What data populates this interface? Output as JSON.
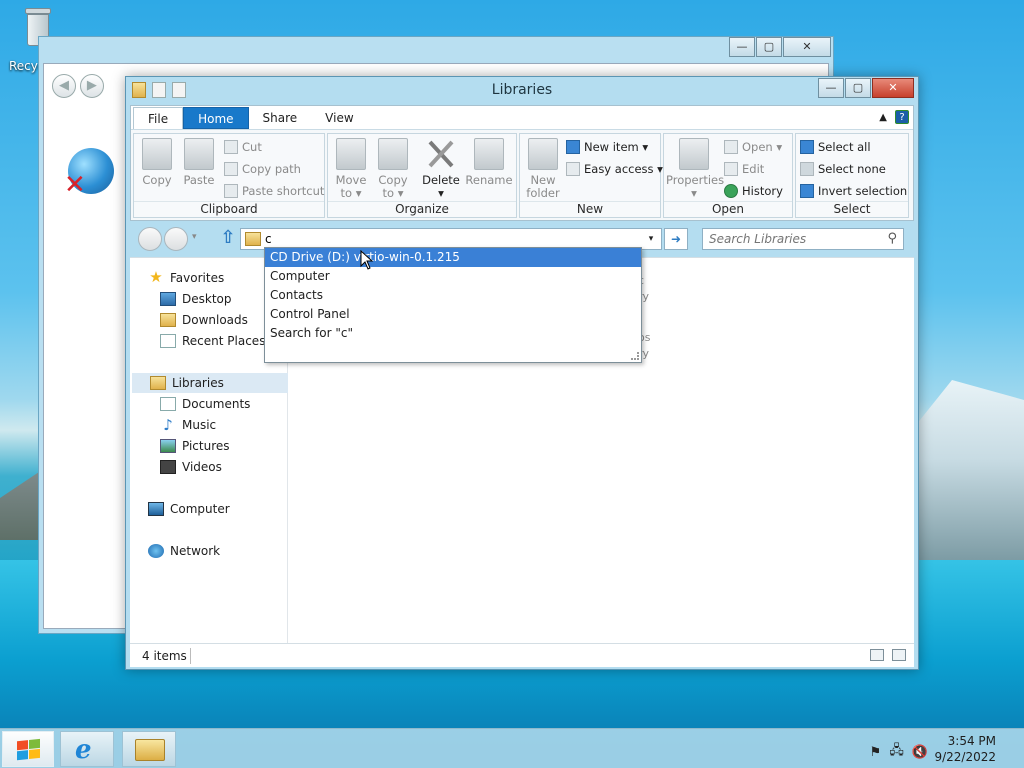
{
  "desktop": {
    "recycle_bin_label": "Recyc"
  },
  "window": {
    "title": "Libraries",
    "controls": {
      "minimize": "—",
      "maximize": "▢",
      "close": "✕"
    }
  },
  "ribbon": {
    "tabs": [
      {
        "label": "File"
      },
      {
        "label": "Home"
      },
      {
        "label": "Share"
      },
      {
        "label": "View"
      }
    ],
    "help": "?",
    "groups": {
      "clipboard": {
        "label": "Clipboard",
        "copy": "Copy",
        "paste": "Paste",
        "cut": "Cut",
        "copy_path": "Copy path",
        "paste_shortcut": "Paste shortcut"
      },
      "organize": {
        "label": "Organize",
        "move_to_1": "Move",
        "move_to_2": "to ▾",
        "copy_to_1": "Copy",
        "copy_to_2": "to ▾",
        "delete": "Delete",
        "delete_arrow": "▾",
        "rename": "Rename"
      },
      "new": {
        "label": "New",
        "new_folder_1": "New",
        "new_folder_2": "folder",
        "new_item": "New item ▾",
        "easy_access": "Easy access ▾"
      },
      "open": {
        "label": "Open",
        "properties": "Properties",
        "properties_arrow": "▾",
        "open": "Open ▾",
        "edit": "Edit",
        "history": "History"
      },
      "select": {
        "label": "Select",
        "select_all": "Select all",
        "select_none": "Select none",
        "invert_selection": "Invert selection"
      }
    }
  },
  "address": {
    "value": "c",
    "dropdown_arrow": "▾",
    "go": "➜",
    "up": "⇧"
  },
  "search": {
    "placeholder": "Search Libraries",
    "icon": "⚲"
  },
  "autocomplete": [
    {
      "label": "CD Drive (D:) virtio-win-0.1.215"
    },
    {
      "label": "Computer"
    },
    {
      "label": "Contacts"
    },
    {
      "label": "Control Panel"
    },
    {
      "label": "Search for \"c\""
    }
  ],
  "navpane": {
    "favorites": "Favorites",
    "desktop": "Desktop",
    "downloads": "Downloads",
    "recent_places": "Recent Places",
    "libraries": "Libraries",
    "documents": "Documents",
    "music": "Music",
    "pictures": "Pictures",
    "videos": "Videos",
    "computer": "Computer",
    "network": "Network"
  },
  "content_ghosts": {
    "a": "c",
    "b": "ry",
    "c": "os",
    "d": "ry"
  },
  "status": {
    "count": "4 items"
  },
  "taskbar": {
    "time": "3:54 PM",
    "date": "9/22/2022",
    "tray_flag": "⚑",
    "tray_network": "🖧",
    "tray_volume": "🔇"
  }
}
